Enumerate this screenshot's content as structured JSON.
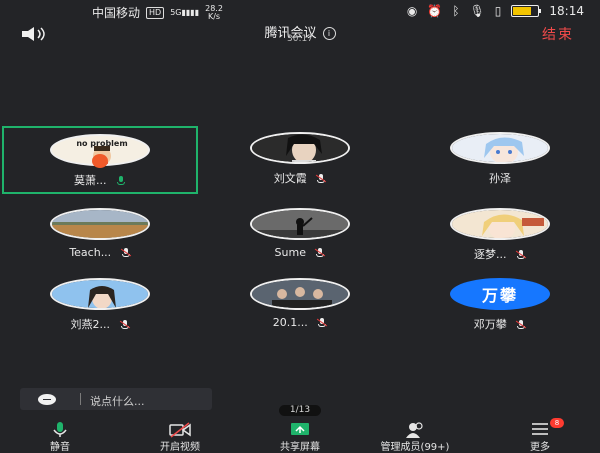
{
  "statusbar": {
    "carrier": "中国移动",
    "hd": "HD",
    "network": "5G",
    "speed_value": "28.2",
    "speed_unit": "K/s",
    "time": "18:14",
    "battery_level": 0.75,
    "battery_color": "#f2c400"
  },
  "header": {
    "title": "腾讯会议",
    "timer": "30:17",
    "end_label": "结束",
    "end_color": "#f04a4a",
    "speaker_icon": "speaker-icon",
    "info_glyph": "i"
  },
  "participants": [
    {
      "name": "莫萧...",
      "mic": "on",
      "avatar": "cartoon-problem",
      "active": true
    },
    {
      "name": "刘文霞",
      "mic": "muted",
      "avatar": "portrait-woman"
    },
    {
      "name": "孙泽",
      "mic": "none",
      "avatar": "anime-girl-blue"
    },
    {
      "name": "Teach...",
      "mic": "muted",
      "avatar": "landscape-field"
    },
    {
      "name": "Sume",
      "mic": "muted",
      "avatar": "silhouette-dark"
    },
    {
      "name": "逐梦...",
      "mic": "muted",
      "avatar": "anime-girl-blonde"
    },
    {
      "name": "刘燕2...",
      "mic": "muted",
      "avatar": "portrait-blue-sky"
    },
    {
      "name": "20.1...",
      "mic": "muted",
      "avatar": "group-photo"
    },
    {
      "name": "邓万攀",
      "mic": "muted",
      "avatar": "text-avatar",
      "avatar_text": "万攀",
      "avatar_color": "#1677ff"
    }
  ],
  "chat": {
    "placeholder": "说点什么..."
  },
  "page_indicator": "1/13",
  "toolbar": {
    "mute": "静音",
    "video": "开启视频",
    "share": "共享屏幕",
    "members": "管理成员(99+)",
    "more": "更多",
    "more_badge": "8",
    "accent_green": "#1fb36b"
  }
}
